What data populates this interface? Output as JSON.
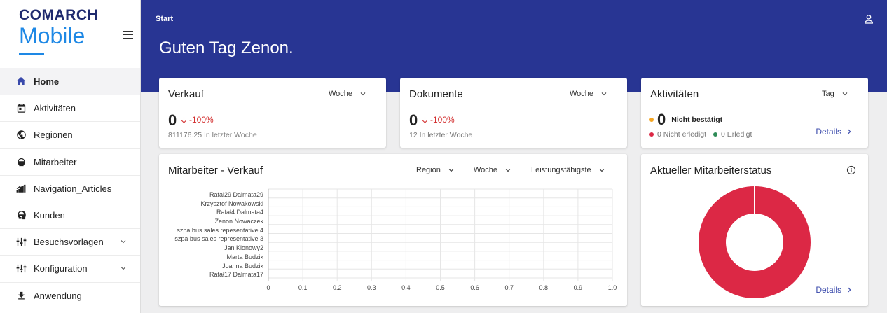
{
  "brand": {
    "line1": "COMARCH",
    "line2": "Mobile"
  },
  "sidebar": {
    "items": [
      {
        "label": "Home",
        "icon": "home-icon",
        "active": true
      },
      {
        "label": "Aktivitäten",
        "icon": "calendar-icon"
      },
      {
        "label": "Regionen",
        "icon": "globe-icon"
      },
      {
        "label": "Mitarbeiter",
        "icon": "person-icon"
      },
      {
        "label": "Navigation_Articles",
        "icon": "chart-bars-icon"
      },
      {
        "label": "Kunden",
        "icon": "customer-icon"
      },
      {
        "label": "Besuchsvorlagen",
        "icon": "sliders-icon",
        "expandable": true
      },
      {
        "label": "Konfiguration",
        "icon": "sliders-icon",
        "expandable": true
      },
      {
        "label": "Anwendung",
        "icon": "download-icon"
      }
    ]
  },
  "header": {
    "breadcrumb": "Start",
    "greeting": "Guten Tag Zenon."
  },
  "verkauf": {
    "title": "Verkauf",
    "period": "Woche",
    "value": "0",
    "delta": "-100%",
    "sub": "811176.25 In letzter Woche"
  },
  "dokumente": {
    "title": "Dokumente",
    "period": "Woche",
    "value": "0",
    "delta": "-100%",
    "sub": "12 In letzter Woche"
  },
  "aktivitaeten": {
    "title": "Aktivitäten",
    "period": "Tag",
    "value": "0",
    "unconfirmed_label": "Nicht bestätigt",
    "not_done": "0 Nicht erledigt",
    "done": "0 Erledigt",
    "details": "Details",
    "colors": {
      "unconfirmed": "#f5a623",
      "not_done": "#dc2845",
      "done": "#2e8b57"
    }
  },
  "mitarbeiter_verkauf": {
    "title": "Mitarbeiter - Verkauf",
    "filter_region": "Region",
    "filter_period": "Woche",
    "filter_sort": "Leistungsfähigste"
  },
  "status": {
    "title": "Aktueller Mitarbeiterstatus",
    "details": "Details"
  },
  "colors": {
    "header": "#283593",
    "accent": "#3949ab",
    "negative": "#d32f2f",
    "donut": "#dc2845"
  },
  "chart_data": [
    {
      "type": "bar",
      "orientation": "horizontal",
      "categories": [
        "Rafał29 Dalmata29",
        "Krzysztof Nowakowski",
        "Rafał4 Dalmata4",
        "Zenon Nowaczek",
        "szpa bus sales repesentative 4",
        "szpa bus sales representative 3",
        "Jan Klonowy2",
        "Marta Budzik",
        "Joanna Budzik",
        "Rafał17 Dalmata17"
      ],
      "values": [
        0,
        0,
        0,
        0,
        0,
        0,
        0,
        0,
        0,
        0
      ],
      "xlim": [
        0,
        1.0
      ],
      "xticks": [
        "0",
        "0.1",
        "0.2",
        "0.3",
        "0.4",
        "0.5",
        "0.6",
        "0.7",
        "0.8",
        "0.9",
        "1.0"
      ],
      "grid": true
    },
    {
      "type": "pie",
      "donut": true,
      "slices": [
        {
          "value": 1
        }
      ]
    }
  ]
}
